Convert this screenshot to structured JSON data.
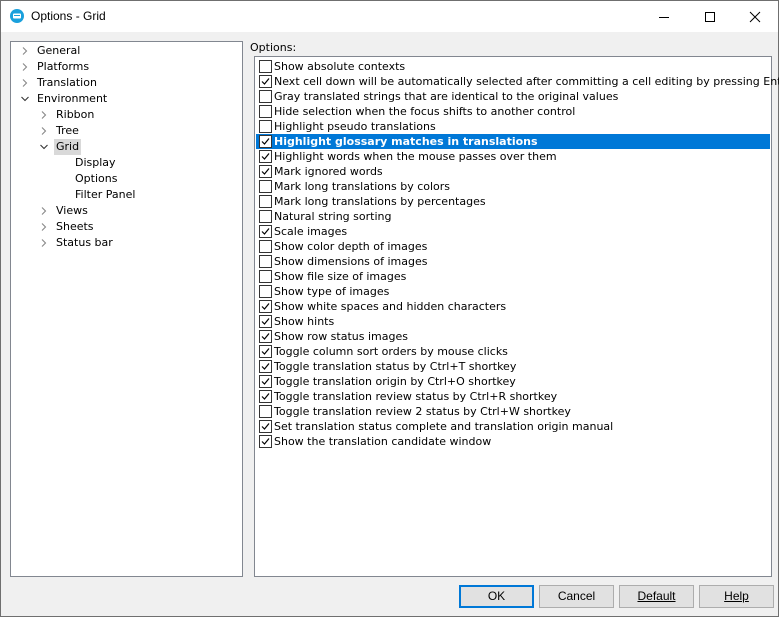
{
  "window": {
    "title": "Options - Grid"
  },
  "tree": [
    {
      "label": "General",
      "level": 0,
      "expander": "collapsed"
    },
    {
      "label": "Platforms",
      "level": 0,
      "expander": "collapsed"
    },
    {
      "label": "Translation",
      "level": 0,
      "expander": "collapsed"
    },
    {
      "label": "Environment",
      "level": 0,
      "expander": "expanded"
    },
    {
      "label": "Ribbon",
      "level": 1,
      "expander": "collapsed"
    },
    {
      "label": "Tree",
      "level": 1,
      "expander": "collapsed"
    },
    {
      "label": "Grid",
      "level": 1,
      "expander": "expanded",
      "selected": true
    },
    {
      "label": "Display",
      "level": 2,
      "expander": "none"
    },
    {
      "label": "Options",
      "level": 2,
      "expander": "none"
    },
    {
      "label": "Filter Panel",
      "level": 2,
      "expander": "none"
    },
    {
      "label": "Views",
      "level": 1,
      "expander": "collapsed"
    },
    {
      "label": "Sheets",
      "level": 1,
      "expander": "collapsed"
    },
    {
      "label": "Status bar",
      "level": 1,
      "expander": "collapsed"
    }
  ],
  "options_label": "Options:",
  "options": [
    {
      "label": "Show absolute contexts",
      "checked": false
    },
    {
      "label": "Next cell down will be automatically selected after committing a cell editing by pressing Enter key",
      "checked": true
    },
    {
      "label": "Gray translated strings that are identical to the original values",
      "checked": false
    },
    {
      "label": "Hide selection when the focus shifts to another control",
      "checked": false
    },
    {
      "label": "Highlight pseudo translations",
      "checked": false
    },
    {
      "label": "Highlight glossary matches in translations",
      "checked": true,
      "selected": true
    },
    {
      "label": "Highlight words when the mouse passes over them",
      "checked": true
    },
    {
      "label": "Mark ignored words",
      "checked": true
    },
    {
      "label": "Mark long translations by colors",
      "checked": false
    },
    {
      "label": "Mark long translations by percentages",
      "checked": false
    },
    {
      "label": "Natural string sorting",
      "checked": false
    },
    {
      "label": "Scale images",
      "checked": true
    },
    {
      "label": "Show color depth of images",
      "checked": false
    },
    {
      "label": "Show dimensions of images",
      "checked": false
    },
    {
      "label": "Show file size of images",
      "checked": false
    },
    {
      "label": "Show type of images",
      "checked": false
    },
    {
      "label": "Show white spaces and hidden characters",
      "checked": true
    },
    {
      "label": "Show hints",
      "checked": true
    },
    {
      "label": "Show row status images",
      "checked": true
    },
    {
      "label": "Toggle column sort orders by mouse clicks",
      "checked": true
    },
    {
      "label": "Toggle translation status by Ctrl+T shortkey",
      "checked": true
    },
    {
      "label": "Toggle translation origin by Ctrl+O shortkey",
      "checked": true
    },
    {
      "label": "Toggle translation review status by Ctrl+R shortkey",
      "checked": true
    },
    {
      "label": "Toggle translation review 2 status by Ctrl+W shortkey",
      "checked": false
    },
    {
      "label": "Set translation status complete and translation origin manual",
      "checked": true
    },
    {
      "label": "Show the translation candidate window",
      "checked": true
    }
  ],
  "buttons": {
    "ok": "OK",
    "cancel": "Cancel",
    "default": "Default",
    "help": "Help"
  },
  "colors": {
    "selection": "#0078d7",
    "tree_selection": "#d9d9d9",
    "accent": "#0078d7"
  }
}
